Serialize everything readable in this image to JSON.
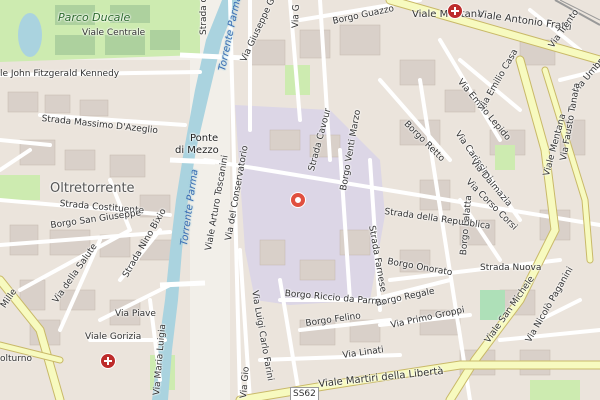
{
  "map": {
    "districts": {
      "oltretorrente": "Oltretorrente"
    },
    "parks": {
      "parco_ducale": "Parco Ducale"
    },
    "water": {
      "torrente_parma_upper": "Torrente Parma",
      "torrente_parma_lower": "Torrente Parma"
    },
    "bridge": {
      "line1": "Ponte",
      "line2": "di Mezzo"
    },
    "roads": {
      "viale_centrale": "Viale Centrale",
      "kennedy": "le John Fitzgerald Kennedy",
      "strada_della_r": "Strada della",
      "garibaldi": "Via Giuseppe Garibaldi",
      "borgo_guazzo": "Borgo Guazzo",
      "via_g": "Via G",
      "viale_mentana": "Viale Mentana",
      "viale_fratti": "Viale Antonio Fratti",
      "via_trento": "Via Trento",
      "via_umbr": "Via Umbr",
      "via_emilio_lepido": "Via Emilio Lepido",
      "via_emilio_casa": "Via Emilio Casa",
      "via_carissimi": "Via Carissimi",
      "borgo_retto": "Borgo Retto",
      "via_fausto": "Via Fausto Tanara",
      "viale_mentana2": "Viale Mentana",
      "azeglio": "Strada Massimo D'Azeglio",
      "strada_cavour": "Strada Cavour",
      "borgo_venti_marzo": "Borgo Venti Marzo",
      "via_dalmazia": "Via Dalmazia",
      "via_corso_corsi": "Via Corso Corsi",
      "via_toscanini": "Viale Arturo Toscanini",
      "conservatorio": "Via del Conservatorio",
      "strada_repubblica": "Strada della Repubblica",
      "costituente": "Strada Costituente",
      "san_giuseppe": "Borgo San Giuseppe",
      "nino_bixio": "Strada Nino Bixio",
      "via_della_salute": "Via della Salute",
      "strada_farnese": "Strada Farnese",
      "via_imbriani": "Via Imbriani",
      "borgo_onorato": "Borgo Onorato",
      "via_nuova": "Strada Nuova",
      "borgo_lalatta": "Borgo Lalatta",
      "viale_san_michele": "Viale San Michele",
      "via_nicolo": "Via Nicolò Paganini",
      "borgo_riccio": "Borgo Riccio da Parma",
      "borgo_regale": "Borgo Regale",
      "via_primo_groppi": "Via Primo Groppi",
      "via_mille": "Mille",
      "via_piave": "Via Piave",
      "viale_gorizia": "Viale Gorizia",
      "via_maria_luigia": "Via Maria Luigia",
      "via_carlo_farini": "Via Luigi Carlo Farini",
      "borgo_felino": "Borgo Felino",
      "via_linati": "Via Linati",
      "vicenzo": "Strada Vicenzo",
      "viale_martiri": "Viale Martiri della Libertà",
      "volturno": "olturno",
      "via_gio": "Via Gio",
      "strada_dell": "Strada dell"
    },
    "road_ref": "SS62"
  }
}
